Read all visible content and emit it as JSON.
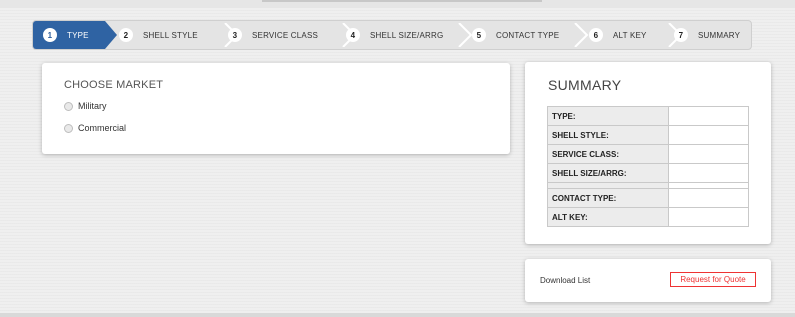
{
  "steps": [
    {
      "num": "1",
      "label": "TYPE"
    },
    {
      "num": "2",
      "label": "SHELL STYLE"
    },
    {
      "num": "3",
      "label": "SERVICE CLASS"
    },
    {
      "num": "4",
      "label": "SHELL SIZE/ARRG"
    },
    {
      "num": "5",
      "label": "CONTACT TYPE"
    },
    {
      "num": "6",
      "label": "ALT KEY"
    },
    {
      "num": "7",
      "label": "SUMMARY"
    }
  ],
  "market": {
    "title": "CHOOSE MARKET",
    "options": [
      "Military",
      "Commercial"
    ]
  },
  "summary": {
    "title": "SUMMARY",
    "rows": [
      {
        "label": "TYPE:",
        "value": ""
      },
      {
        "label": "SHELL STYLE:",
        "value": ""
      },
      {
        "label": "SERVICE CLASS:",
        "value": ""
      },
      {
        "label": "SHELL SIZE/ARRG:",
        "value": ""
      },
      {
        "label": "CONTACT TYPE:",
        "value": ""
      },
      {
        "label": "ALT KEY:",
        "value": ""
      }
    ]
  },
  "actions": {
    "download": "Download List",
    "quote": "Request for Quote"
  },
  "colors": {
    "active_step": "#2f63a3",
    "quote_red": "#e33333"
  }
}
